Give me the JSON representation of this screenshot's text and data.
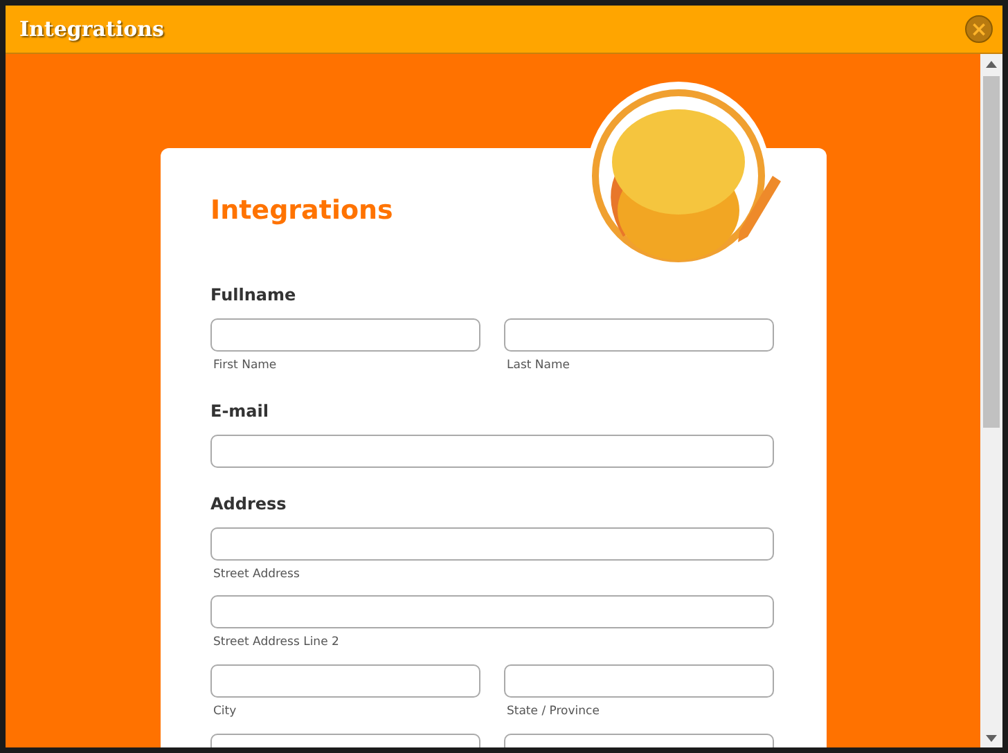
{
  "window": {
    "title": "Integrations",
    "close": "×"
  },
  "form": {
    "heading": "Integrations",
    "sections": [
      {
        "label": "Fullname",
        "rows": [
          [
            {
              "kind": "text",
              "sublabel": "First Name"
            },
            {
              "kind": "text",
              "sublabel": "Last Name"
            }
          ]
        ]
      },
      {
        "label": "E-mail",
        "rows": [
          [
            {
              "kind": "text"
            }
          ]
        ]
      },
      {
        "label": "Address",
        "rows": [
          [
            {
              "kind": "text",
              "sublabel": "Street Address"
            }
          ],
          [
            {
              "kind": "text",
              "sublabel": "Street Address Line 2"
            }
          ],
          [
            {
              "kind": "text",
              "sublabel": "City"
            },
            {
              "kind": "text",
              "sublabel": "State / Province"
            }
          ],
          [
            {
              "kind": "text"
            },
            {
              "kind": "text"
            }
          ]
        ]
      }
    ]
  }
}
